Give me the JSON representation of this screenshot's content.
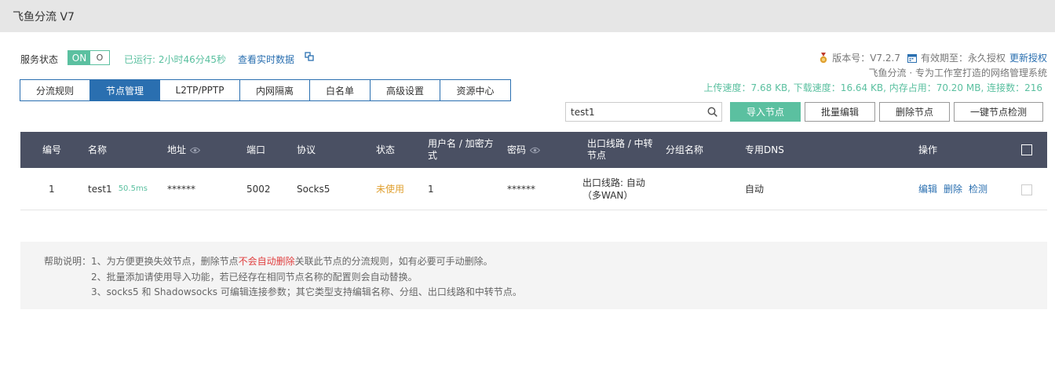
{
  "app": {
    "title": "飞鱼分流 V7"
  },
  "service": {
    "label": "服务状态",
    "toggle_on": "ON",
    "toggle_off": "O",
    "uptime": "已运行: 2小时46分45秒",
    "realtime_link": "查看实时数据"
  },
  "version": {
    "version_text": "版本号：V7.2.7",
    "expiry_text": "有效期至：永久授权",
    "update_link": "更新授权",
    "subtitle": "飞鱼分流 · 专为工作室打造的网络管理系统",
    "stats": "上传速度：7.68 KB, 下载速度：16.64 KB, 内存占用：70.20 MB, 连接数：216"
  },
  "tabs": [
    {
      "label": "分流规则"
    },
    {
      "label": "节点管理"
    },
    {
      "label": "L2TP/PPTP"
    },
    {
      "label": "内网隔离"
    },
    {
      "label": "白名单"
    },
    {
      "label": "高级设置"
    },
    {
      "label": "资源中心"
    }
  ],
  "active_tab": "节点管理",
  "toolbar": {
    "search_value": "test1",
    "import_label": "导入节点",
    "batch_edit_label": "批量编辑",
    "delete_label": "删除节点",
    "check_label": "一键节点检测"
  },
  "table": {
    "headers": {
      "id": "编号",
      "name": "名称",
      "address": "地址",
      "port": "端口",
      "protocol": "协议",
      "status": "状态",
      "user": "用户名 / 加密方式",
      "password": "密码",
      "route": "出口线路 / 中转节点",
      "group": "分组名称",
      "dns": "专用DNS",
      "ops": "操作"
    },
    "rows": [
      {
        "id": "1",
        "name": "test1",
        "latency": "50.5ms",
        "address": "******",
        "port": "5002",
        "protocol": "Socks5",
        "status": "未使用",
        "user": "1",
        "password": "******",
        "route": "出口线路: 自动（多WAN）",
        "group": "",
        "dns": "自动",
        "op_edit": "编辑",
        "op_delete": "删除",
        "op_check": "检测"
      }
    ]
  },
  "help": {
    "label": "帮助说明：",
    "line1_a": "1、为方便更换失效节点，删除节点",
    "line1_red": "不会自动删除",
    "line1_b": "关联此节点的分流规则，如有必要可手动删除。",
    "line2": "2、批量添加请使用导入功能，若已经存在相同节点名称的配置则会自动替换。",
    "line3": "3、socks5 和 Shadowsocks 可编辑连接参数；其它类型支持编辑名称、分组、出口线路和中转节点。"
  },
  "colors": {
    "accent_green": "#5bc0a0",
    "accent_blue": "#2a6fb0",
    "header_dark": "#4a5063",
    "warning": "#e0a030",
    "danger": "#e04040"
  }
}
